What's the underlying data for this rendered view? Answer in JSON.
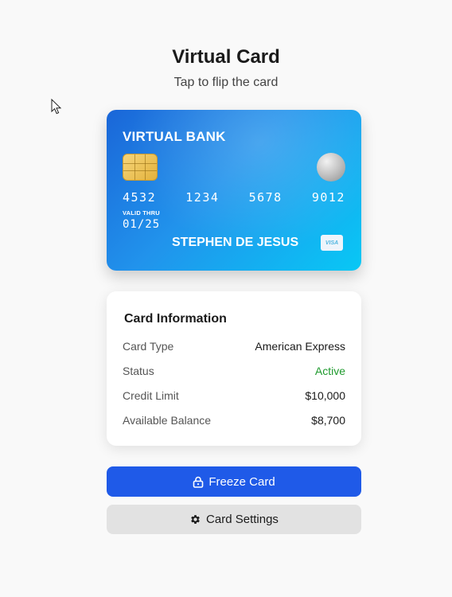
{
  "header": {
    "title": "Virtual Card",
    "subtitle": "Tap to flip the card"
  },
  "card": {
    "bank_name": "VIRTUAL BANK",
    "number_groups": [
      "4532",
      "1234",
      "5678",
      "9012"
    ],
    "valid_thru_label": "VALID THRU",
    "expiry": "01/25",
    "holder_name": "STEPHEN DE JESUS",
    "network": "VISA",
    "colors": {
      "gradient_start": "#1a66d8",
      "gradient_end": "#08c8f5"
    }
  },
  "info": {
    "title": "Card Information",
    "rows": [
      {
        "label": "Card Type",
        "value": "American Express"
      },
      {
        "label": "Status",
        "value": "Active"
      },
      {
        "label": "Credit Limit",
        "value": "$10,000"
      },
      {
        "label": "Available Balance",
        "value": "$8,700"
      }
    ],
    "status_color": "#1f9a2e"
  },
  "actions": {
    "freeze_label": "Freeze Card",
    "freeze_icon": "lock-icon",
    "settings_label": "Card Settings",
    "settings_icon": "gear-icon",
    "primary_color": "#1f5ae8"
  },
  "cursor": {
    "icon": "mouse-pointer-icon"
  }
}
